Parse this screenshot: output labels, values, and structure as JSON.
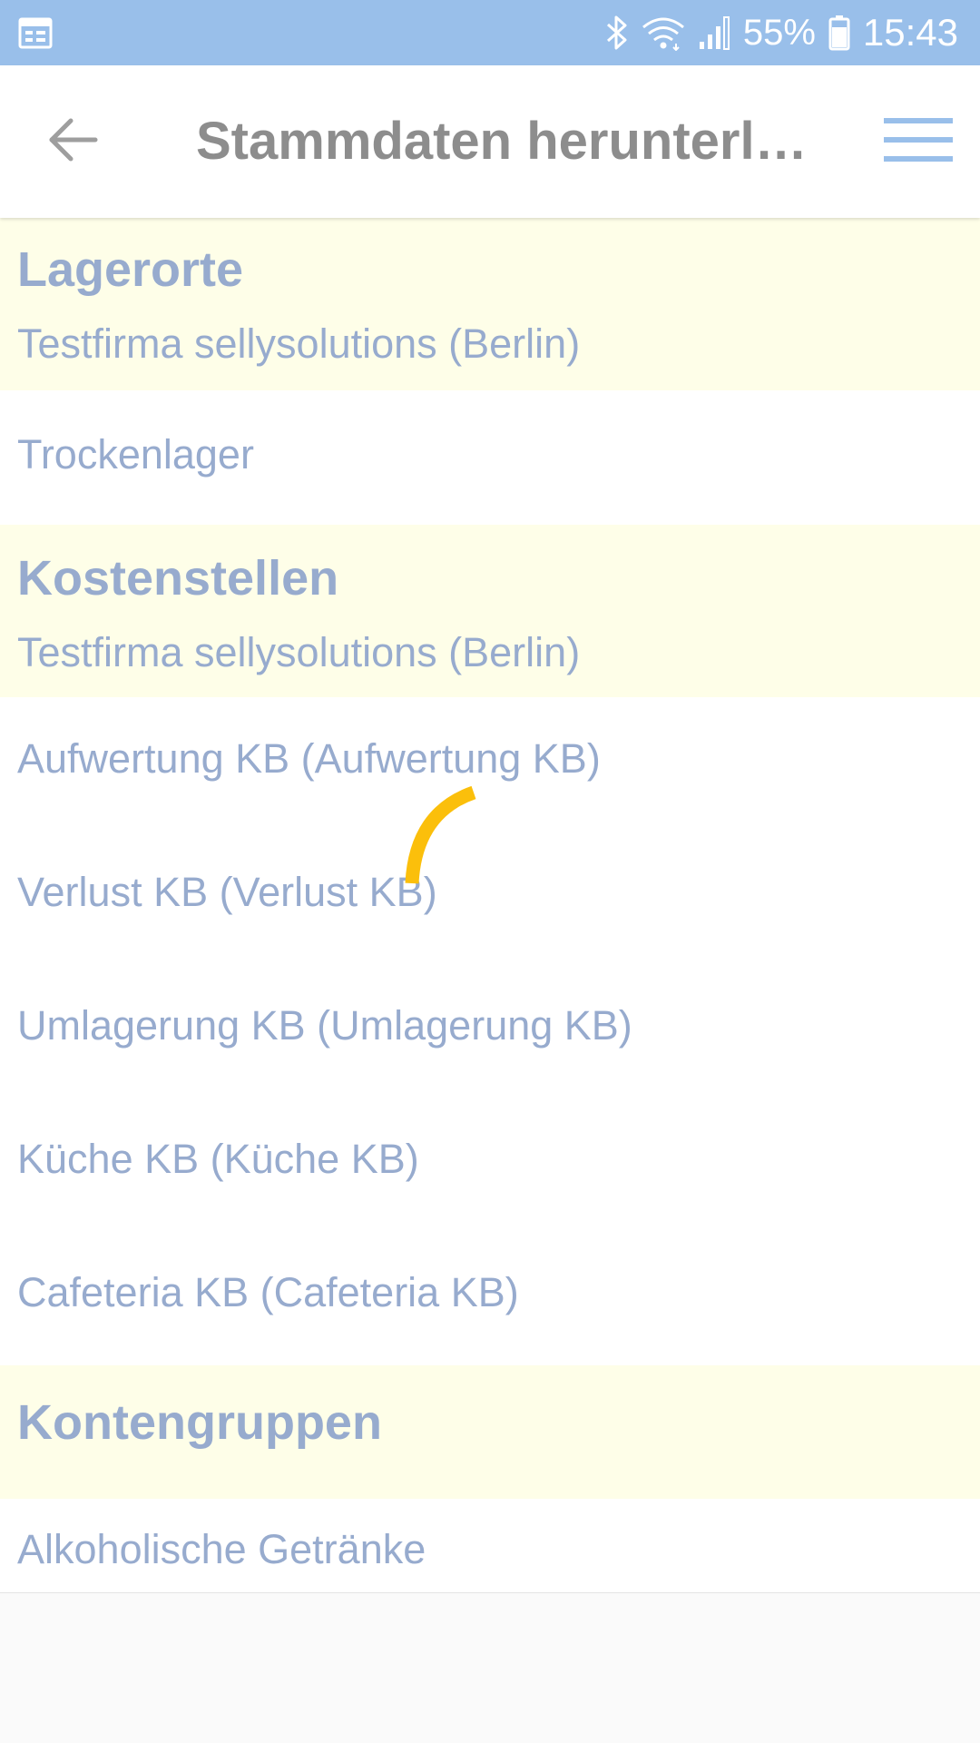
{
  "status_bar": {
    "battery_percent": "55%",
    "time": "15:43",
    "icons": [
      "calendar-icon",
      "bluetooth-icon",
      "wifi-icon",
      "signal-icon",
      "battery-icon"
    ]
  },
  "app_bar": {
    "title": "Stammdaten herunterla…",
    "back_icon": "arrow-left-icon",
    "menu_icon": "hamburger-menu-icon",
    "accent_color": "#99bfea"
  },
  "sections": {
    "lagerorte": {
      "title": "Lagerorte",
      "subtitle": "Testfirma sellysolutions (Berlin)",
      "items": [
        "Trockenlager"
      ]
    },
    "kostenstellen": {
      "title": "Kostenstellen",
      "subtitle": "Testfirma sellysolutions (Berlin)",
      "items": [
        "Aufwertung KB (Aufwertung KB)",
        "Verlust KB (Verlust KB)",
        "Umlagerung KB (Umlagerung KB)",
        "Küche KB (Küche KB)",
        "Cafeteria KB (Cafeteria KB)"
      ]
    },
    "kontengruppen": {
      "title": "Kontengruppen",
      "items": [
        "Alkoholische Getränke"
      ]
    }
  },
  "colors": {
    "header_background": "#fefee8",
    "text": "#97abce",
    "spinner": "#fbbf0b"
  }
}
